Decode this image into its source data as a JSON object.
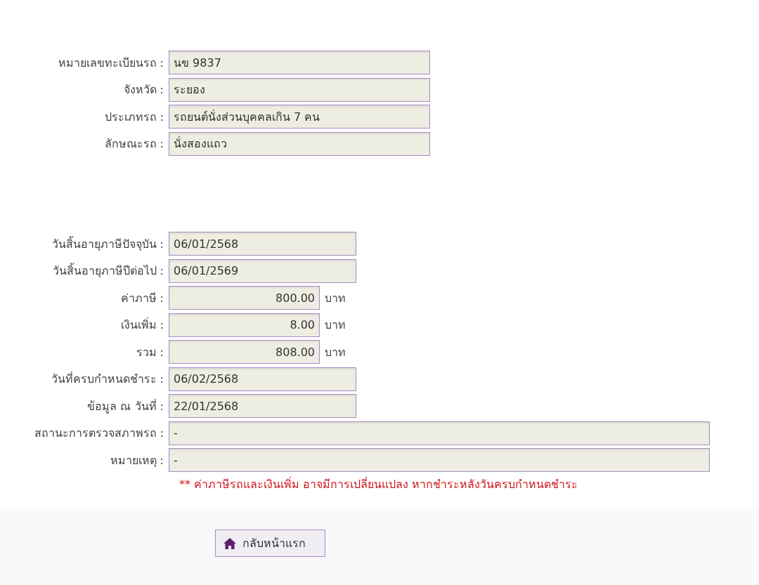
{
  "vehicle_section": {
    "fields": [
      {
        "label": "หมายเลขทะเบียนรถ :",
        "value": "นข 9837",
        "kind": "medium"
      },
      {
        "label": "จังหวัด :",
        "value": "ระยอง",
        "kind": "medium"
      },
      {
        "label": "ประเภทรถ :",
        "value": "รถยนต์นั่งส่วนบุคคลเกิน 7 คน",
        "kind": "medium"
      },
      {
        "label": "ลักษณะรถ :",
        "value": "นั่งสองแถว",
        "kind": "medium"
      }
    ]
  },
  "tax_section": {
    "fields": [
      {
        "label": "วันสิ้นอายุภาษีปัจจุบัน :",
        "value": "06/01/2568",
        "kind": "short"
      },
      {
        "label": "วันสิ้นอายุภาษีปีต่อไป :",
        "value": "06/01/2569",
        "kind": "short"
      },
      {
        "label": "ค่าภาษี :",
        "value": "800.00",
        "kind": "money",
        "unit": "บาท"
      },
      {
        "label": "เงินเพิ่ม :",
        "value": "8.00",
        "kind": "money",
        "unit": "บาท"
      },
      {
        "label": "รวม :",
        "value": "808.00",
        "kind": "money",
        "unit": "บาท"
      },
      {
        "label": "วันที่ครบกำหนดชำระ :",
        "value": "06/02/2568",
        "kind": "short"
      },
      {
        "label": "ข้อมูล ณ วันที่ :",
        "value": "22/01/2568",
        "kind": "short"
      },
      {
        "label": "สถานะการตรวจสภาพรถ :",
        "value": "-",
        "kind": "long"
      },
      {
        "label": "หมายเหตุ :",
        "value": "-",
        "kind": "long"
      }
    ],
    "note": "** ค่าภาษีรถและเงินเพิ่ม อาจมีการเปลี่ยนแปลง หากชำระหลังวันครบกำหนดชำระ"
  },
  "footer": {
    "home_button": "กลับหน้าแรก"
  }
}
